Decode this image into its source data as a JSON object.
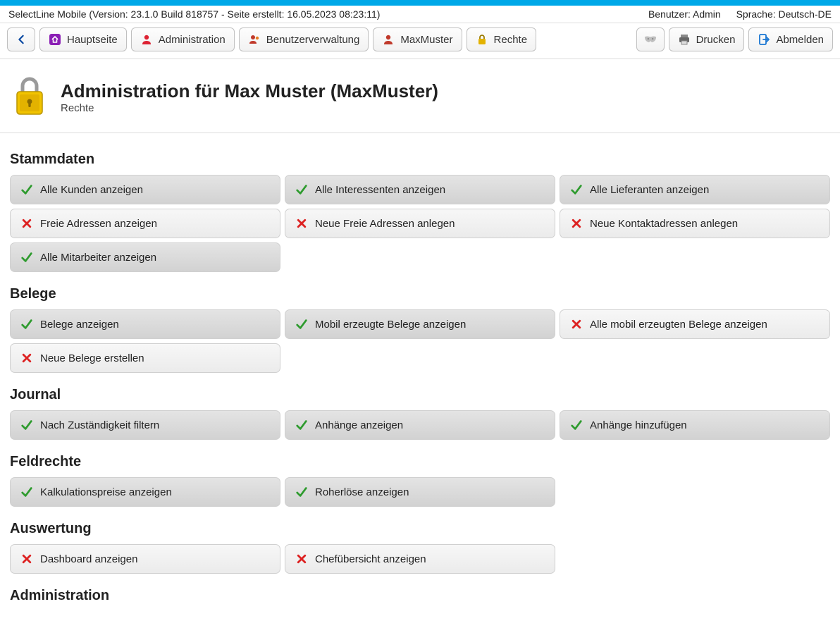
{
  "meta": {
    "version_line": "SelectLine Mobile (Version: 23.1.0 Build 818757 - Seite erstellt: 16.05.2023 08:23:11)",
    "user_label": "Benutzer: Admin",
    "lang_label": "Sprache: Deutsch-DE"
  },
  "toolbar": {
    "home": "Hauptseite",
    "admin": "Administration",
    "usermgmt": "Benutzerverwaltung",
    "user": "MaxMuster",
    "rights": "Rechte",
    "print": "Drucken",
    "logout": "Abmelden"
  },
  "header": {
    "title": "Administration für Max Muster (MaxMuster)",
    "subtitle": "Rechte"
  },
  "sections": [
    {
      "title": "Stammdaten",
      "items": [
        {
          "label": "Alle Kunden anzeigen",
          "enabled": true
        },
        {
          "label": "Alle Interessenten anzeigen",
          "enabled": true
        },
        {
          "label": "Alle Lieferanten anzeigen",
          "enabled": true
        },
        {
          "label": "Freie Adressen anzeigen",
          "enabled": false
        },
        {
          "label": "Neue Freie Adressen anlegen",
          "enabled": false
        },
        {
          "label": "Neue Kontaktadressen anlegen",
          "enabled": false
        },
        {
          "label": "Alle Mitarbeiter anzeigen",
          "enabled": true
        }
      ]
    },
    {
      "title": "Belege",
      "items": [
        {
          "label": "Belege anzeigen",
          "enabled": true
        },
        {
          "label": "Mobil erzeugte Belege anzeigen",
          "enabled": true
        },
        {
          "label": "Alle mobil erzeugten Belege anzeigen",
          "enabled": false
        },
        {
          "label": "Neue Belege erstellen",
          "enabled": false
        }
      ]
    },
    {
      "title": "Journal",
      "items": [
        {
          "label": "Nach Zuständigkeit filtern",
          "enabled": true
        },
        {
          "label": "Anhänge anzeigen",
          "enabled": true
        },
        {
          "label": "Anhänge hinzufügen",
          "enabled": true
        }
      ]
    },
    {
      "title": "Feldrechte",
      "items": [
        {
          "label": "Kalkulationspreise anzeigen",
          "enabled": true
        },
        {
          "label": "Roherlöse anzeigen",
          "enabled": true
        }
      ]
    },
    {
      "title": "Auswertung",
      "items": [
        {
          "label": "Dashboard anzeigen",
          "enabled": false
        },
        {
          "label": "Chefübersicht anzeigen",
          "enabled": false
        }
      ]
    },
    {
      "title": "Administration",
      "items": []
    }
  ]
}
